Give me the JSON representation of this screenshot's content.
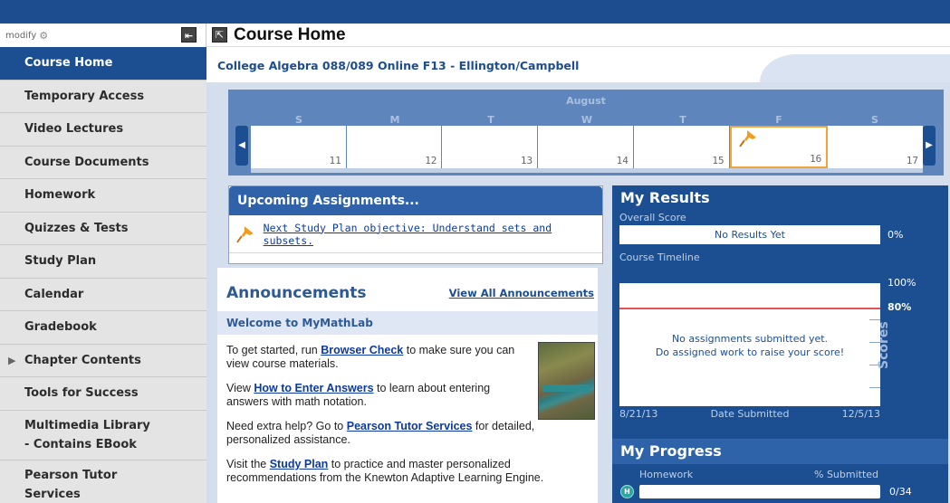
{
  "sidebar": {
    "modify_label": "modify",
    "items": [
      {
        "label": "Course Home"
      },
      {
        "label": "Temporary Access"
      },
      {
        "label": "Video Lectures"
      },
      {
        "label": "Course Documents"
      },
      {
        "label": "Homework"
      },
      {
        "label": "Quizzes & Tests"
      },
      {
        "label": "Study Plan"
      },
      {
        "label": "Calendar"
      },
      {
        "label": "Gradebook"
      },
      {
        "label": "Chapter Contents"
      },
      {
        "label": "Tools for Success"
      },
      {
        "label_line1": "Multimedia Library",
        "label_line2": "- Contains EBook"
      },
      {
        "label_line1": "Pearson Tutor",
        "label_line2": "Services"
      }
    ]
  },
  "header": {
    "title": "Course Home",
    "course_title": "College Algebra 088/089 Online F13 - Ellington/Campbell"
  },
  "calendar": {
    "month": "August",
    "days": [
      "S",
      "M",
      "T",
      "W",
      "T",
      "F",
      "S"
    ],
    "dates": [
      "11",
      "12",
      "13",
      "14",
      "15",
      "16",
      "17"
    ],
    "today_index": 5
  },
  "upcoming": {
    "title": "Upcoming Assignments...",
    "item": "Next Study Plan objective: Understand sets and subsets."
  },
  "announcements": {
    "title": "Announcements",
    "view_all": "View All Announcements",
    "welcome": "Welcome to MyMathLab",
    "p1_pre": "To get started, run ",
    "p1_link": "Browser Check",
    "p1_post": " to make sure you can view course materials.",
    "p2_pre": "View ",
    "p2_link": "How to Enter Answers",
    "p2_post": " to learn about entering answers with math notation.",
    "p3_pre": "Need extra help? Go to ",
    "p3_link": "Pearson Tutor Services",
    "p3_post": " for detailed, personalized assistance.",
    "p4_pre": "Visit the ",
    "p4_link": "Study Plan",
    "p4_post": " to practice and master personalized recommendations from the Knewton Adaptive Learning Engine."
  },
  "results": {
    "title": "My Results",
    "overall_label": "Overall Score",
    "overall_value": "No Results Yet",
    "overall_pct": "0%",
    "timeline_label": "Course Timeline",
    "timeline_msg1": "No assignments submitted yet.",
    "timeline_msg2": "Do assigned work to raise your score!",
    "y_top": "100%",
    "y_line": "80%",
    "y_axis_label": "Scores",
    "x_start": "8/21/13",
    "x_label": "Date Submitted",
    "x_end": "12/5/13"
  },
  "progress": {
    "title": "My Progress",
    "col_label": "Homework",
    "col_pct_label": "% Submitted",
    "badge": "H",
    "value": "0/34",
    "fraction": 0
  },
  "colors": {
    "brand": "#1c4f91",
    "highlight": "#f0a43a",
    "threshold": "#e45353"
  },
  "icons": {
    "gear": "gear-icon",
    "collapse": "collapse-sidebar-icon",
    "expand": "expand-icon",
    "pin": "pushpin-icon"
  }
}
